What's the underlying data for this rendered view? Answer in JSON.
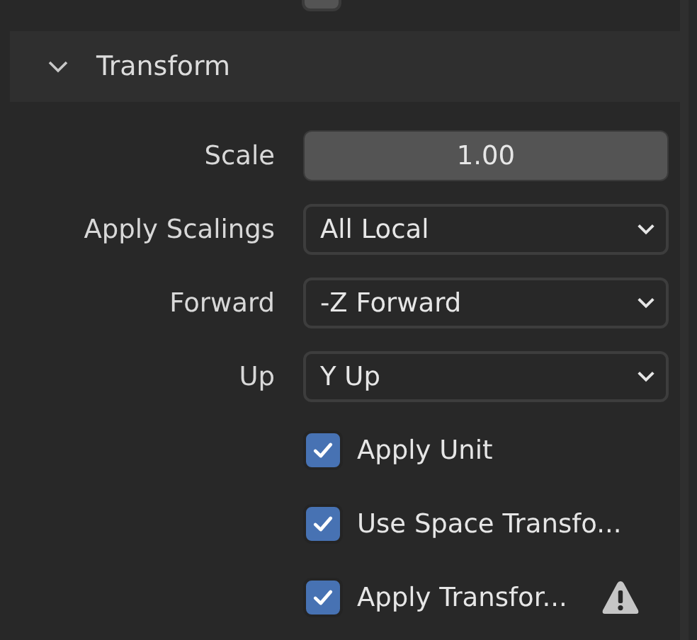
{
  "top_checkbox": {
    "checked": false
  },
  "panel": {
    "title": "Transform",
    "expanded": true
  },
  "fields": [
    {
      "kind": "number",
      "label": "Scale",
      "value": "1.00"
    },
    {
      "kind": "dropdown",
      "label": "Apply Scalings",
      "value": "All Local"
    },
    {
      "kind": "dropdown",
      "label": "Forward",
      "value": "-Z Forward"
    },
    {
      "kind": "dropdown",
      "label": "Up",
      "value": "Y Up"
    }
  ],
  "checkboxes": [
    {
      "label": "Apply Unit",
      "checked": true,
      "warning": false
    },
    {
      "label": "Use Space Transfo...",
      "checked": true,
      "warning": false
    },
    {
      "label": "Apply Transfor...",
      "checked": true,
      "warning": true
    }
  ]
}
